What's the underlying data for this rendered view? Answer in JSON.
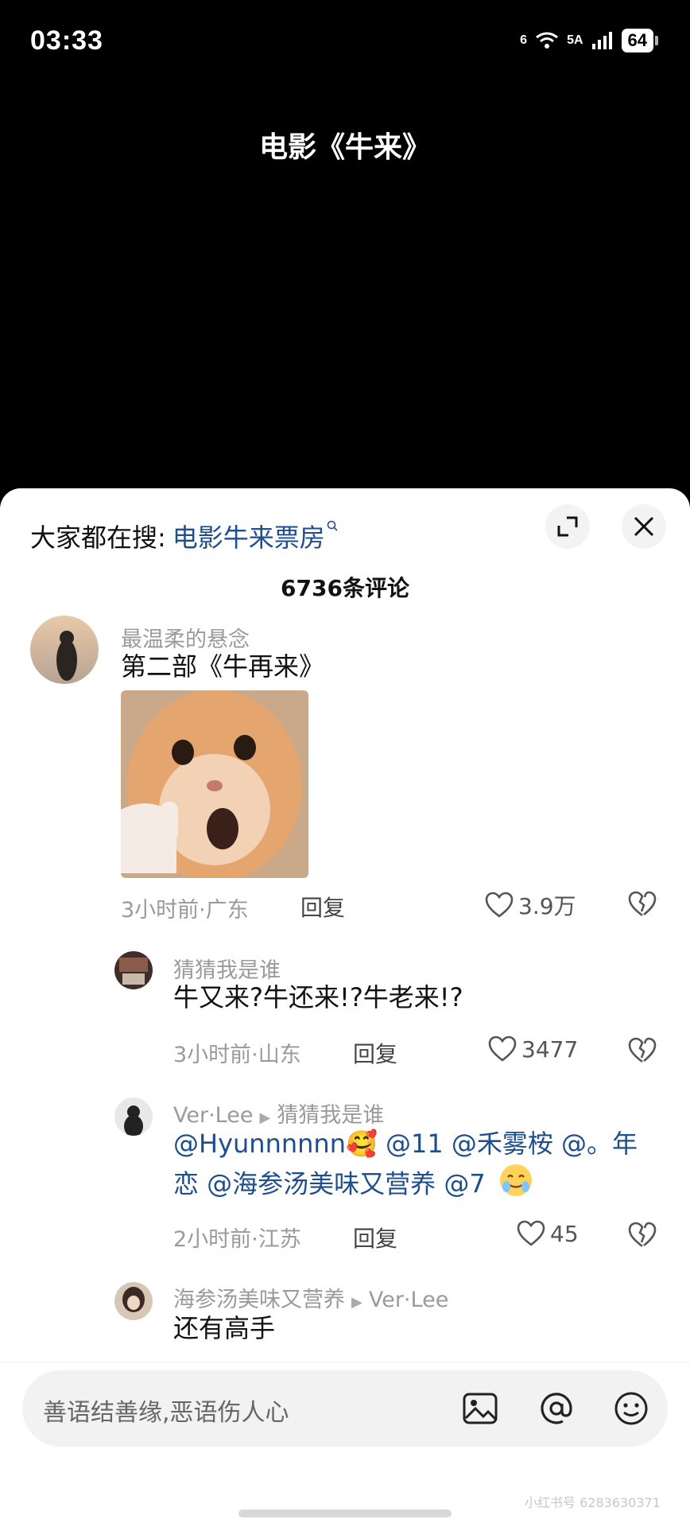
{
  "status_bar": {
    "time": "03:33",
    "net1": "6",
    "net2": "5A",
    "battery": "64"
  },
  "video": {
    "title": "电影《牛来》"
  },
  "sheet": {
    "search_label": "大家都在搜:",
    "search_term": "电影牛来票房",
    "comment_count": "6736条评论"
  },
  "comments": [
    {
      "user": "最温柔的悬念",
      "text": "第二部《牛再来》",
      "meta": "3小时前·广东",
      "reply": "回复",
      "likes": "3.9万"
    },
    {
      "user": "猜猜我是谁",
      "text": "牛又来?牛还来!?牛老来!?",
      "meta": "3小时前·山东",
      "reply": "回复",
      "likes": "3477"
    },
    {
      "user": "Ver·Lee",
      "reply_to": "猜猜我是谁",
      "text_line1": "@Hyunnnnnn🥰 @11 @禾雾桉 @。年",
      "text_line2": "恋 @海参汤美味又营养 @7",
      "meta": "2小时前·江苏",
      "reply": "回复",
      "likes": "45"
    },
    {
      "user": "海参汤美味又营养",
      "reply_to": "Ver·Lee",
      "text": "还有高手"
    }
  ],
  "input": {
    "placeholder": "善语结善缘,恶语伤人心"
  },
  "watermark": "小红书号 6283630371"
}
